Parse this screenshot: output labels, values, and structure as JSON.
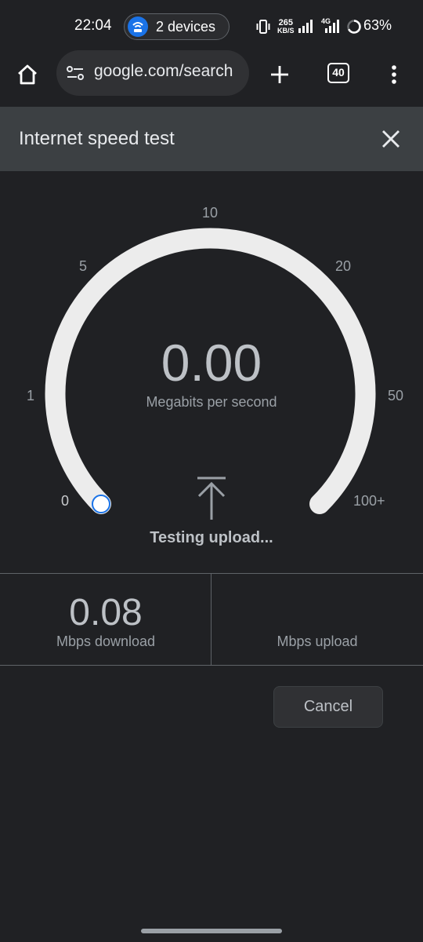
{
  "status_bar": {
    "time": "22:04",
    "hotspot_label": "2 devices",
    "net_speed_value": "265",
    "net_speed_unit": "KB/S",
    "network_type": "4G",
    "battery": "63%"
  },
  "browser": {
    "url": "google.com/search",
    "tab_count": "40",
    "icons": [
      "home-icon",
      "site-settings-icon",
      "new-tab-icon",
      "tab-switcher-icon",
      "more-menu-icon"
    ]
  },
  "dialog": {
    "title": "Internet speed test",
    "close_icon": "close-icon"
  },
  "gauge": {
    "ticks": [
      "0",
      "1",
      "5",
      "10",
      "20",
      "50",
      "100+"
    ],
    "value": "0.00",
    "unit": "Megabits per second",
    "status": "Testing upload...",
    "needle_level": 0,
    "arc_color": "#ececec",
    "indicator_color": "#1a73e8"
  },
  "results": {
    "download_value": "0.08",
    "download_label": "Mbps download",
    "upload_value": "",
    "upload_label": "Mbps upload"
  },
  "actions": {
    "cancel_label": "Cancel"
  }
}
